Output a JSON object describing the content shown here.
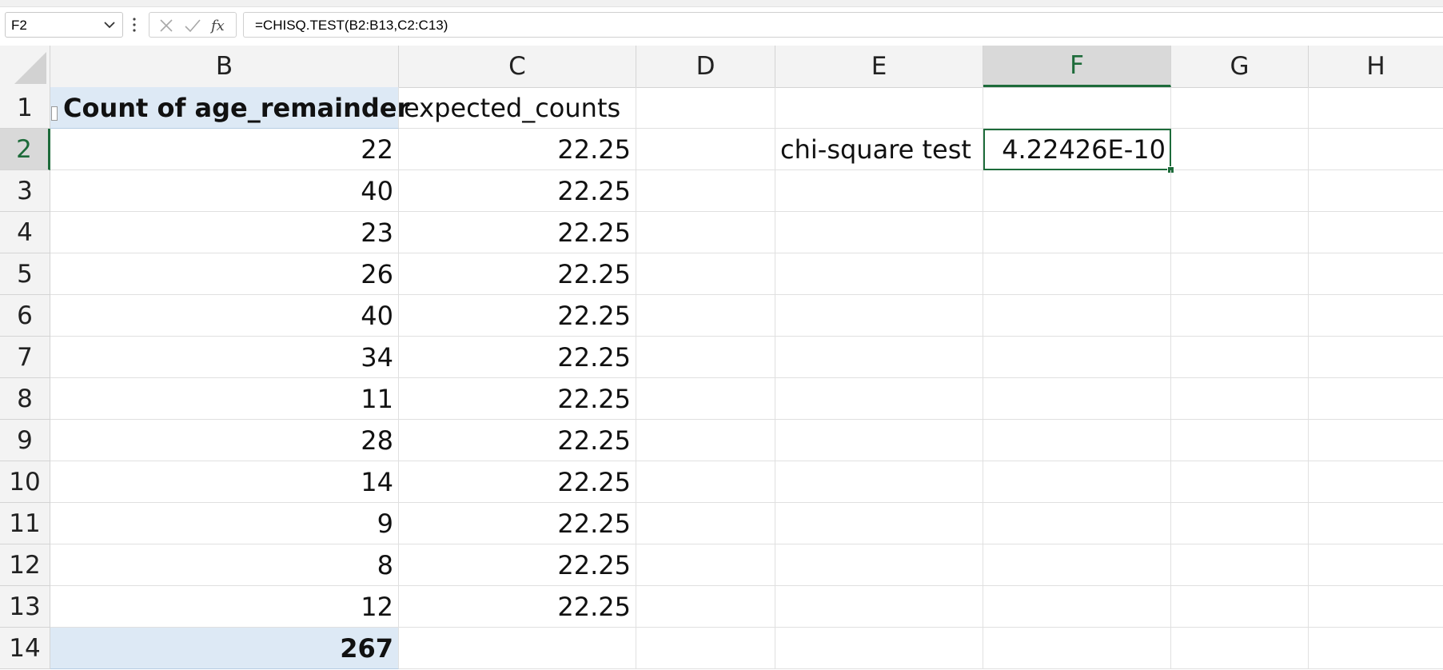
{
  "formula_bar": {
    "name_box": "F2",
    "formula": "=CHISQ.TEST(B2:B13,C2:C13)"
  },
  "icons": {
    "name_box_dropdown": "chevron-down-icon",
    "more": "vertical-dots-icon",
    "cancel": "x-icon",
    "enter": "check-icon",
    "insert_function": "fx-icon",
    "select_all": "select-all-triangle-icon"
  },
  "colors": {
    "selected_header": "#1d6b3a",
    "pivot_fill": "#dde9f5"
  },
  "columns": [
    "B",
    "C",
    "D",
    "E",
    "F",
    "G",
    "H"
  ],
  "rows": [
    "1",
    "2",
    "3",
    "4",
    "5",
    "6",
    "7",
    "8",
    "9",
    "10",
    "11",
    "12",
    "13",
    "14"
  ],
  "cells": {
    "B1": "Count of age_remainder",
    "C1": "expected_counts",
    "B2": "22",
    "C2": "22.25",
    "E2": "chi-square test",
    "F2": "4.22426E-10",
    "B3": "40",
    "C3": "22.25",
    "B4": "23",
    "C4": "22.25",
    "B5": "26",
    "C5": "22.25",
    "B6": "40",
    "C6": "22.25",
    "B7": "34",
    "C7": "22.25",
    "B8": "11",
    "C8": "22.25",
    "B9": "28",
    "C9": "22.25",
    "B10": "14",
    "C10": "22.25",
    "B11": "9",
    "C11": "22.25",
    "B12": "8",
    "C12": "22.25",
    "B13": "12",
    "C13": "22.25",
    "B14": "267"
  },
  "selection": {
    "active_cell": "F2",
    "active_col": "F",
    "active_row": "2"
  }
}
